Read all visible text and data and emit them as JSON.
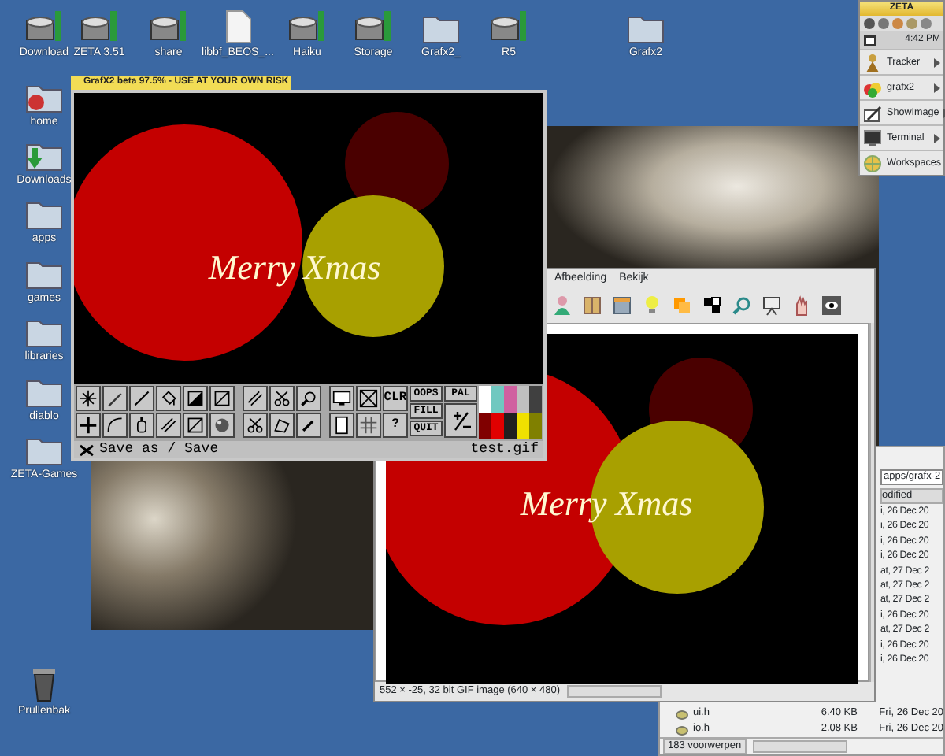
{
  "desktop_icons": [
    {
      "label": "Download",
      "kind": "drive"
    },
    {
      "label": "ZETA 3.51",
      "kind": "drive"
    },
    {
      "label": "share",
      "kind": "drive"
    },
    {
      "label": "libbf_BEOS_...",
      "kind": "document"
    },
    {
      "label": "Haiku",
      "kind": "drive"
    },
    {
      "label": "Storage",
      "kind": "drive"
    },
    {
      "label": "Grafx2_",
      "kind": "folder"
    },
    {
      "label": "R5",
      "kind": "drive"
    },
    {
      "label": "Grafx2",
      "kind": "folder"
    },
    {
      "label": "home",
      "kind": "home"
    },
    {
      "label": "Downloads",
      "kind": "downloads"
    },
    {
      "label": "apps",
      "kind": "folder"
    },
    {
      "label": "games",
      "kind": "folder"
    },
    {
      "label": "libraries",
      "kind": "folder"
    },
    {
      "label": "diablo",
      "kind": "folder"
    },
    {
      "label": "ZETA-Games",
      "kind": "folder"
    },
    {
      "label": "Prullenbak",
      "kind": "trash"
    }
  ],
  "deskbar": {
    "title": "ZETA",
    "clock": "4:42 PM",
    "items": [
      {
        "label": "Tracker"
      },
      {
        "label": "grafx2"
      },
      {
        "label": "ShowImage"
      },
      {
        "label": "Terminal"
      },
      {
        "label": "Workspaces"
      }
    ]
  },
  "grafx2": {
    "title": "GrafX2 beta 97.5% - USE AT YOUR OWN RISK",
    "canvas_text": "Merry Xmas",
    "text_buttons": [
      {
        "label": "CLR"
      },
      {
        "label": "?"
      },
      {
        "label": "OOPS"
      },
      {
        "label": "FILL"
      },
      {
        "label": "QUIT"
      },
      {
        "label": "PAL"
      }
    ],
    "palette": [
      {
        "color": "#ffffff"
      },
      {
        "color": "#70c8c0"
      },
      {
        "color": "#d060a0"
      },
      {
        "color": "#c0c0c0"
      },
      {
        "color": "#404040"
      },
      {
        "color": "#800000"
      },
      {
        "color": "#e00000"
      },
      {
        "color": "#202020"
      },
      {
        "color": "#f0e000"
      },
      {
        "color": "#808000"
      }
    ],
    "status": "Save as / Save",
    "filename": "test.gif"
  },
  "showimage": {
    "menu": [
      "Afbeelding",
      "Bekijk"
    ],
    "image_text": "Merry Xmas",
    "status": "552 × -25, 32 bit GIF image (640 × 480)"
  },
  "tracker": {
    "path": "apps/grafx-2",
    "column_header": "odified",
    "rows": [
      {
        "date": "i, 26 Dec 20"
      },
      {
        "date": "i, 26 Dec 20"
      },
      {
        "date": "i, 26 Dec 20"
      },
      {
        "date": "i, 26 Dec 20"
      },
      {
        "date": "at, 27 Dec 2"
      },
      {
        "date": "at, 27 Dec 2"
      },
      {
        "date": "at, 27 Dec 2"
      },
      {
        "date": "i, 26 Dec 20"
      },
      {
        "date": "at, 27 Dec 2"
      },
      {
        "date": "i, 26 Dec 20"
      },
      {
        "date": "i, 26 Dec 20"
      }
    ],
    "files": [
      {
        "name": "ui.h",
        "size": "6.40 KB",
        "date": "Fri, 26 Dec 20"
      },
      {
        "name": "io.h",
        "size": "2.08 KB",
        "date": "Fri, 26 Dec 20"
      }
    ],
    "status": "183 voorwerpen"
  }
}
